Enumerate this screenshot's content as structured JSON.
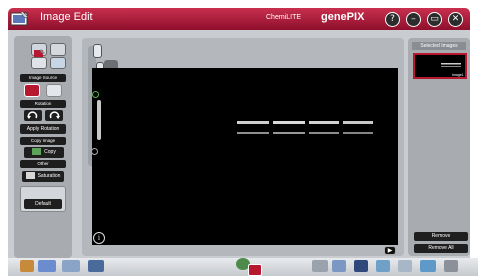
{
  "window": {
    "title": "Image Edit",
    "model": "ChemiLITE",
    "brand": "genePIX",
    "controls": [
      "?",
      "–",
      "▭",
      "✕"
    ]
  },
  "left_panel": {
    "image_source_label": "Image Source",
    "rotation_label": "Rotation",
    "apply_rotation_label": "Apply Rotation",
    "copy_image_label": "Copy Image",
    "copy_button_label": "Copy",
    "other_label": "Other",
    "saturation_label": "Saturation",
    "default_label": "Default"
  },
  "right_panel": {
    "selected_label": "Selected Images",
    "thumbnail_name": "Image1",
    "remove_label": "Remove",
    "remove_all_label": "Remove All"
  },
  "colors": {
    "brand": "#a81c3a",
    "panel": "#a8acb1",
    "canvas": "#000000"
  },
  "icons": {
    "info": "info-icon",
    "expand": "expand-icon",
    "rotate_left": "rotate-left-icon",
    "rotate_right": "rotate-right-icon"
  }
}
